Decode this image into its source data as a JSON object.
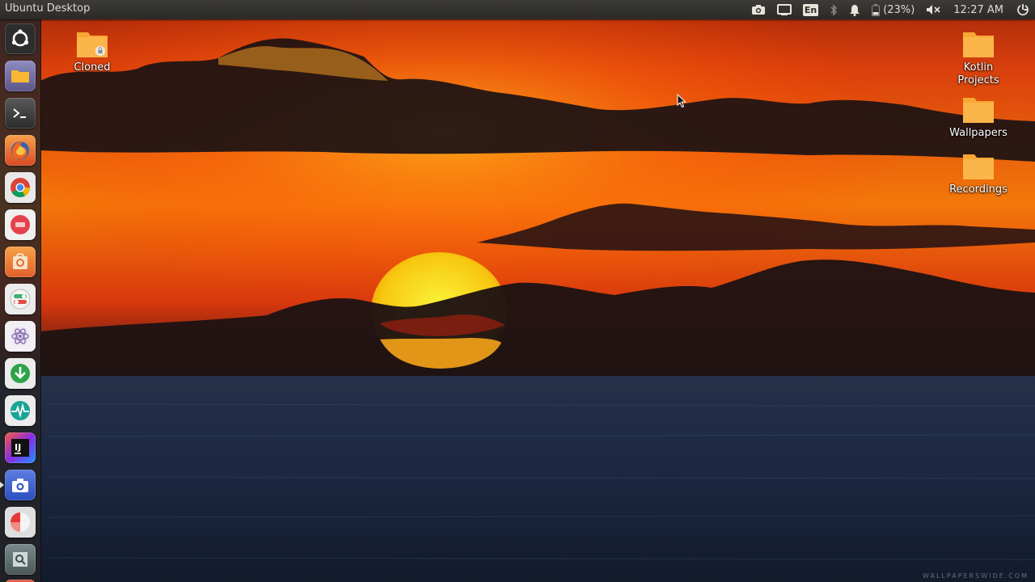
{
  "panel": {
    "title": "Ubuntu Desktop",
    "language": "En",
    "battery": "(23%)",
    "clock": "12:27 AM"
  },
  "indicators": [
    "screenshot-camera-icon",
    "display-icon",
    "keyboard-language-icon",
    "bluetooth-icon",
    "notification-bell-icon",
    "battery-icon",
    "volume-muted-icon",
    "session-power-icon"
  ],
  "launcher": {
    "items": [
      {
        "name": "dash-home-icon",
        "bg": "#3a3a3a"
      },
      {
        "name": "files-icon",
        "bg": "#6e6a98"
      },
      {
        "name": "terminal-icon",
        "bg": "#4a4a4a"
      },
      {
        "name": "firefox-icon",
        "bg": "#e5582a"
      },
      {
        "name": "chrome-icon",
        "bg": "#d24a3a"
      },
      {
        "name": "app-red-icon",
        "bg": "#e0424a"
      },
      {
        "name": "software-center-icon",
        "bg": "#ef7b2f"
      },
      {
        "name": "toggle-settings-icon",
        "bg": "#3fae70"
      },
      {
        "name": "atom-editor-icon",
        "bg": "#d0c8dc"
      },
      {
        "name": "download-manager-icon",
        "bg": "#2ea34a"
      },
      {
        "name": "system-monitor-icon",
        "bg": "#1fa89a"
      },
      {
        "name": "intellij-idea-icon",
        "bg": "#3a5ad8"
      },
      {
        "name": "screenshot-app-icon",
        "bg": "#3a5ed0"
      },
      {
        "name": "pie-app-icon",
        "bg": "#d8d8d8"
      },
      {
        "name": "network-app-icon",
        "bg": "#5b6d6d"
      },
      {
        "name": "trash-icon",
        "bg": "#c84a3a"
      }
    ]
  },
  "desktop": {
    "icons": [
      {
        "name": "cloned-folder",
        "label": "Cloned",
        "locked": true
      },
      {
        "name": "kotlin-projects-folder",
        "label": "Kotlin\nProjects"
      },
      {
        "name": "wallpapers-folder",
        "label": "Wallpapers"
      },
      {
        "name": "recordings-folder",
        "label": "Recordings"
      }
    ]
  },
  "wallpaper": {
    "watermark": "WALLPAPERSWIDE.COM"
  },
  "colors": {
    "panel_bg": "#3c3b37",
    "folder_orange": "#f7a833",
    "sky_top": "#b32a08",
    "sun": "#f6e31a",
    "sea": "#1d2b44"
  }
}
